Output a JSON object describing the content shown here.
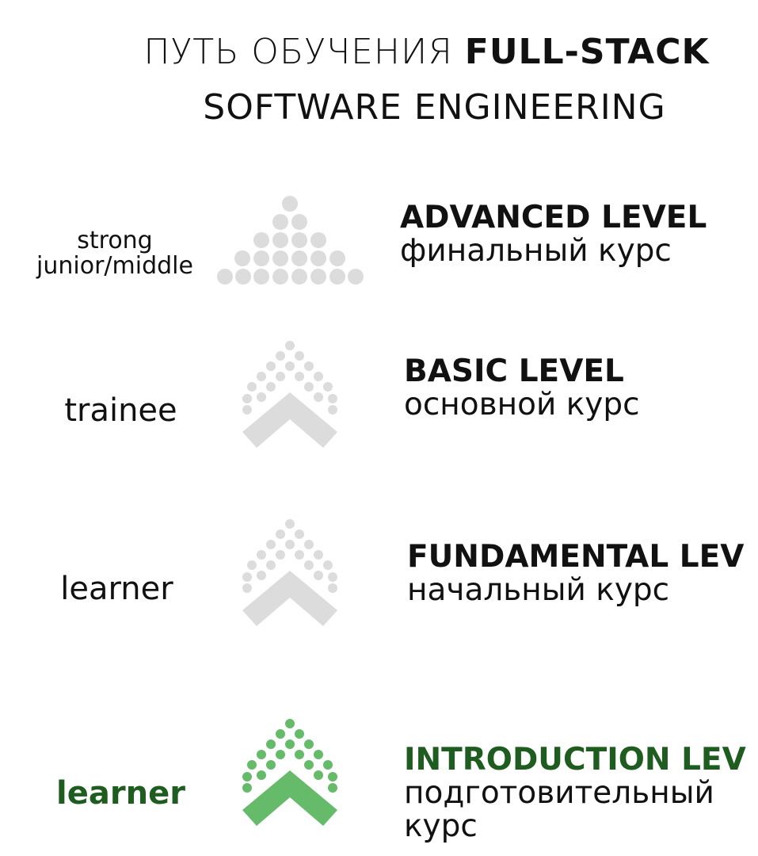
{
  "title": {
    "line1_light": "ПУТЬ ОБУЧЕНИЯ ",
    "line1_bold": "FULL-STACK",
    "line2": "SOFTWARE ENGINEERING"
  },
  "levels": [
    {
      "role_line1": "strong",
      "role_line2": "junior/middle",
      "title": "ADVANCED LEVEL",
      "subtitle": "финальный курс",
      "icon": "dot-pyramid-icon",
      "color": "#dcdcdc"
    },
    {
      "role": "trainee",
      "title": "BASIC LEVEL",
      "subtitle": "основной курс",
      "icon": "dotted-chevron-up-icon",
      "color": "#dcdcdc"
    },
    {
      "role": "learner",
      "title": "FUNDAMENTAL LEV",
      "subtitle": "начальный курс",
      "icon": "dotted-chevron-up-icon",
      "color": "#dcdcdc"
    },
    {
      "role": "learner",
      "title": "INTRODUCTION LEV",
      "subtitle_line1": "подготовительный",
      "subtitle_line2": "курс",
      "icon": "dotted-chevron-up-icon",
      "color": "#66bb6a",
      "text_color": "#1f5c1f"
    }
  ]
}
